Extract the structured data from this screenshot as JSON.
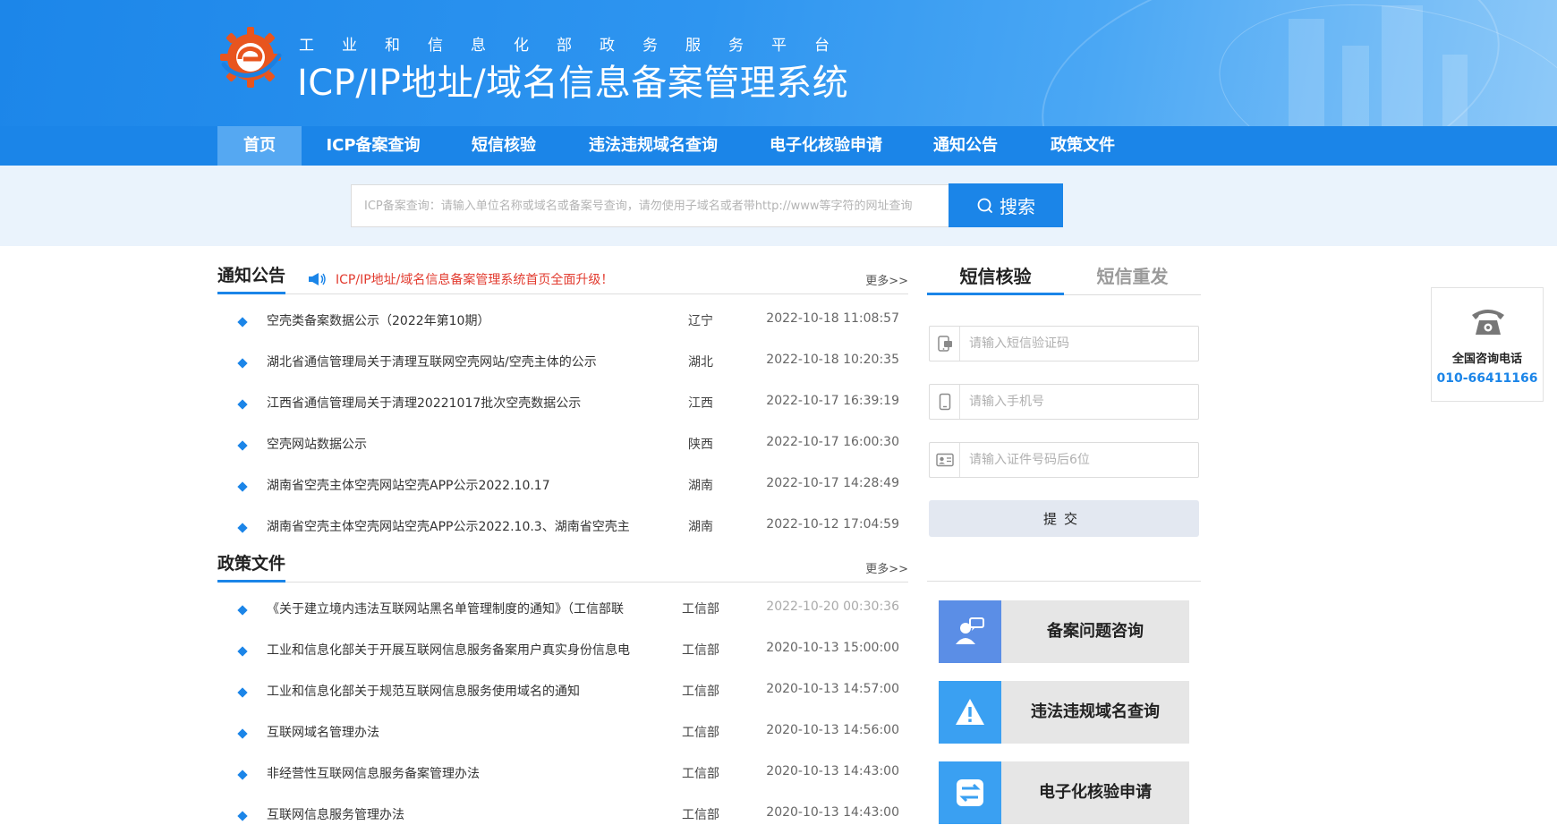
{
  "header": {
    "subtitle": "工业和信息化部政务服务平台",
    "title": "ICP/IP地址/域名信息备案管理系统"
  },
  "nav": {
    "items": [
      "首页",
      "ICP备案查询",
      "短信核验",
      "违法违规域名查询",
      "电子化核验申请",
      "通知公告",
      "政策文件"
    ],
    "active": "首页"
  },
  "search": {
    "placeholder": "ICP备案查询：请输入单位名称或域名或备案号查询，请勿使用子域名或者带http://www等字符的网址查询",
    "button_label": "搜索"
  },
  "notices": {
    "title": "通知公告",
    "ticker": "ICP/IP地址/域名信息备案管理系统首页全面升级！",
    "more": "更多>>",
    "items": [
      {
        "title": "空壳类备案数据公示（2022年第10期）",
        "province": "辽宁",
        "date": "2022-10-18 11:08:57"
      },
      {
        "title": "湖北省通信管理局关于清理互联网空壳网站/空壳主体的公示",
        "province": "湖北",
        "date": "2022-10-18 10:20:35"
      },
      {
        "title": "江西省通信管理局关于清理20221017批次空壳数据公示",
        "province": "江西",
        "date": "2022-10-17 16:39:19"
      },
      {
        "title": "空壳网站数据公示",
        "province": "陕西",
        "date": "2022-10-17 16:00:30"
      },
      {
        "title": "湖南省空壳主体空壳网站空壳APP公示2022.10.17",
        "province": "湖南",
        "date": "2022-10-17 14:28:49"
      },
      {
        "title": "湖南省空壳主体空壳网站空壳APP公示2022.10.3、湖南省空壳主",
        "province": "湖南",
        "date": "2022-10-12 17:04:59"
      }
    ]
  },
  "policies": {
    "title": "政策文件",
    "more": "更多>>",
    "items": [
      {
        "title": "《关于建立境内违法互联网站黑名单管理制度的通知》（工信部联",
        "source": "工信部",
        "date": "2022-10-20 00:30:36"
      },
      {
        "title": "工业和信息化部关于开展互联网信息服务备案用户真实身份信息电",
        "source": "工信部",
        "date": "2020-10-13 15:00:00"
      },
      {
        "title": "工业和信息化部关于规范互联网信息服务使用域名的通知",
        "source": "工信部",
        "date": "2020-10-13 14:57:00"
      },
      {
        "title": "互联网域名管理办法",
        "source": "工信部",
        "date": "2020-10-13 14:56:00"
      },
      {
        "title": "非经营性互联网信息服务备案管理办法",
        "source": "工信部",
        "date": "2020-10-13 14:43:00"
      },
      {
        "title": "互联网信息服务管理办法",
        "source": "工信部",
        "date": "2020-10-13 14:43:00"
      }
    ]
  },
  "sms_panel": {
    "tab_active": "短信核验",
    "tab_inactive": "短信重发",
    "code_placeholder": "请输入短信验证码",
    "phone_placeholder": "请输入手机号",
    "id_placeholder": "请输入证件号码后6位",
    "submit_label": "提交"
  },
  "quick_links": [
    {
      "label": "备案问题咨询",
      "icon": "consult-icon",
      "color": "#5b8ee6"
    },
    {
      "label": "违法违规域名查询",
      "icon": "warning-icon",
      "color": "#3aa0f2"
    },
    {
      "label": "电子化核验申请",
      "icon": "transfer-icon",
      "color": "#3aa0f2"
    }
  ],
  "hotline": {
    "label": "全国咨询电话",
    "number": "010-66411166"
  },
  "colors": {
    "primary": "#1b85e8",
    "nav_active": "#55a8f2",
    "ticker": "#e23b2f"
  }
}
